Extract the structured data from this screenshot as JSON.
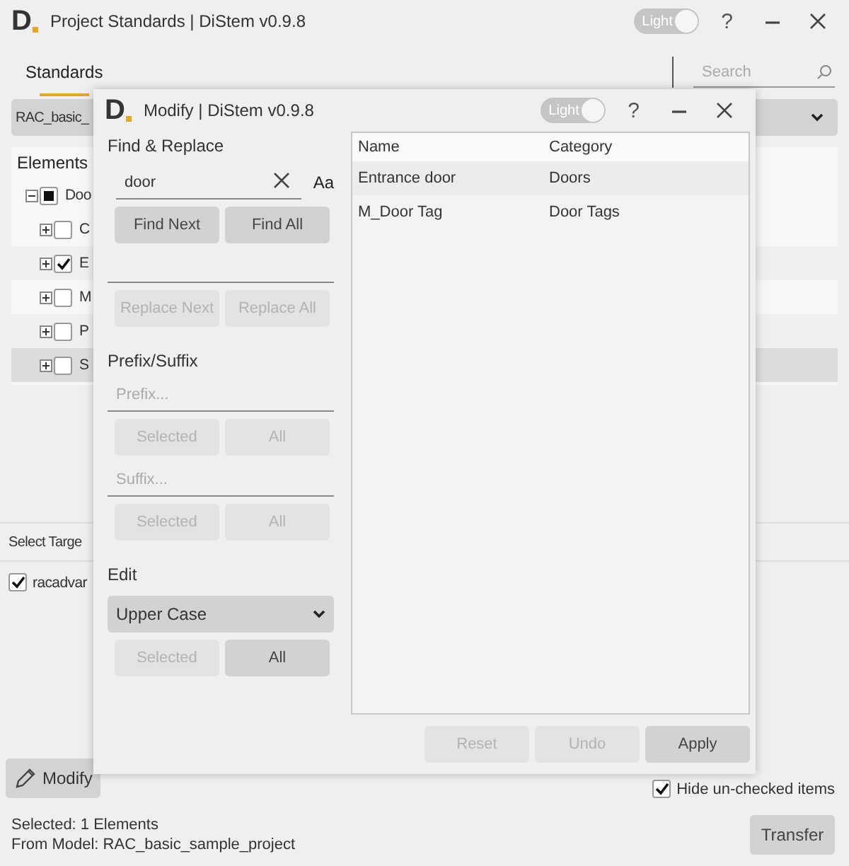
{
  "window": {
    "logo": "D",
    "title": "Project Standards | DiStem v0.9.8",
    "theme_toggle": "Light",
    "help": "?"
  },
  "tabs": [
    {
      "label": "Standards",
      "selected": true
    }
  ],
  "search": {
    "placeholder": "Search"
  },
  "model_dropdown": {
    "value": "RAC_basic_"
  },
  "elements": {
    "title": "Elements",
    "tree": [
      {
        "label": "Doo",
        "checked": false,
        "indeterminate": true,
        "expanded": true,
        "selected": false,
        "children": [
          {
            "label": "C",
            "checked": false,
            "expanded": false,
            "selected": false
          },
          {
            "label": "E",
            "checked": true,
            "expanded": false,
            "selected": false
          },
          {
            "label": "M",
            "checked": false,
            "expanded": false,
            "selected": false
          },
          {
            "label": "P",
            "checked": false,
            "expanded": false,
            "selected": false
          },
          {
            "label": "S",
            "checked": false,
            "expanded": false,
            "selected": true
          }
        ]
      }
    ]
  },
  "targets": {
    "title": "Select Targe",
    "items": [
      {
        "label": "racadvar",
        "checked": true
      }
    ]
  },
  "modify_button": "Modify",
  "hide_unchecked": {
    "label": "Hide un-checked items",
    "checked": true
  },
  "status": [
    "Selected: 1 Elements",
    "From Model: RAC_basic_sample_project"
  ],
  "transfer_button": "Transfer",
  "modal": {
    "logo": "D",
    "title": "Modify | DiStem v0.9.8",
    "theme_toggle": "Light",
    "help": "?",
    "find_replace": {
      "title": "Find & Replace",
      "find_value": "door",
      "match_case": "Aa",
      "find_buttons": [
        {
          "label": "Find Next",
          "disabled": false
        },
        {
          "label": "Find All",
          "disabled": false
        }
      ],
      "replace_buttons": [
        {
          "label": "Replace Next",
          "disabled": true
        },
        {
          "label": "Replace All",
          "disabled": true
        }
      ]
    },
    "prefix_suffix": {
      "title": "Prefix/Suffix",
      "prefix_placeholder": "Prefix...",
      "prefix_buttons": [
        {
          "label": "Selected",
          "disabled": true
        },
        {
          "label": "All",
          "disabled": true
        }
      ],
      "suffix_placeholder": "Suffix...",
      "suffix_buttons": [
        {
          "label": "Selected",
          "disabled": true
        },
        {
          "label": "All",
          "disabled": true
        }
      ]
    },
    "edit": {
      "title": "Edit",
      "mode": "Upper Case",
      "buttons": [
        {
          "label": "Selected",
          "disabled": true
        },
        {
          "label": "All",
          "disabled": false
        }
      ]
    },
    "table": {
      "columns": [
        "Name",
        "Category"
      ],
      "rows": [
        [
          "Entrance door",
          "Doors"
        ],
        [
          "M_Door Tag",
          "Door Tags"
        ]
      ]
    },
    "footer_buttons": [
      {
        "label": "Reset",
        "disabled": true
      },
      {
        "label": "Undo",
        "disabled": true
      },
      {
        "label": "Apply",
        "disabled": false
      }
    ]
  }
}
